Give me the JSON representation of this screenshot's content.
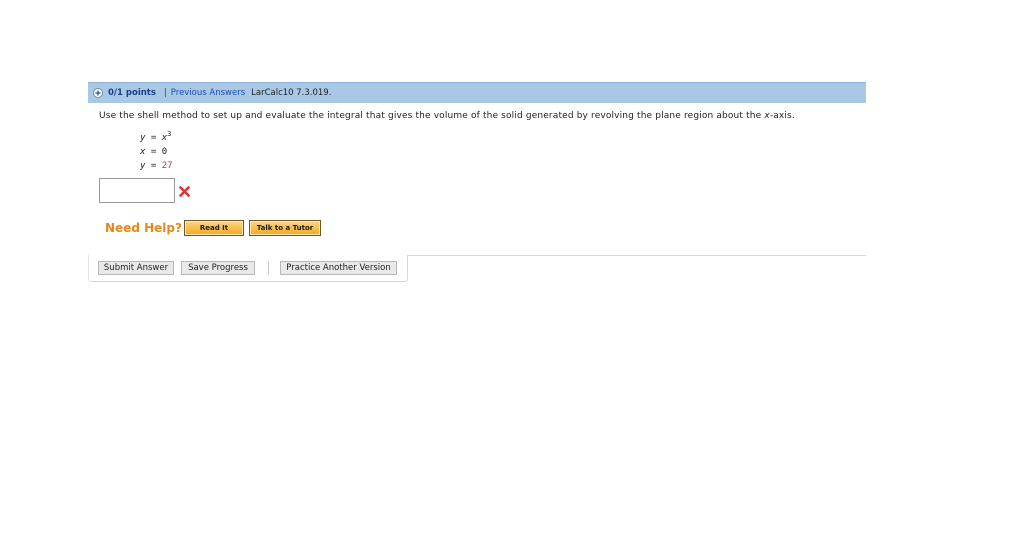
{
  "header": {
    "points": "0/1 points",
    "separator": "|",
    "previous_answers": "Previous Answers",
    "reference": "LarCalc10 7.3.019."
  },
  "question": {
    "prompt_before": "Use the shell method to set up and evaluate the integral that gives the volume of the solid generated by revolving the plane region about the ",
    "prompt_var": "x",
    "prompt_after": "-axis.",
    "equations": [
      {
        "lhs": "y",
        "op": "=",
        "rhs_base": "x",
        "rhs_sup": "3"
      },
      {
        "lhs": "x",
        "op": "=",
        "rhs": "0"
      },
      {
        "lhs": "y",
        "op": "=",
        "rhs": "27"
      }
    ]
  },
  "answer": {
    "value": "",
    "status": "incorrect"
  },
  "help": {
    "label": "Need Help?",
    "read_it": "Read It",
    "talk_to_tutor": "Talk to a Tutor"
  },
  "actions": {
    "submit": "Submit Answer",
    "save": "Save Progress",
    "practice": "Practice Another Version"
  },
  "colors": {
    "header_bg": "#a8c8e6",
    "need_help": "#e48a1a",
    "incorrect": "#dd3333",
    "highlight_value": "#cc3333"
  }
}
